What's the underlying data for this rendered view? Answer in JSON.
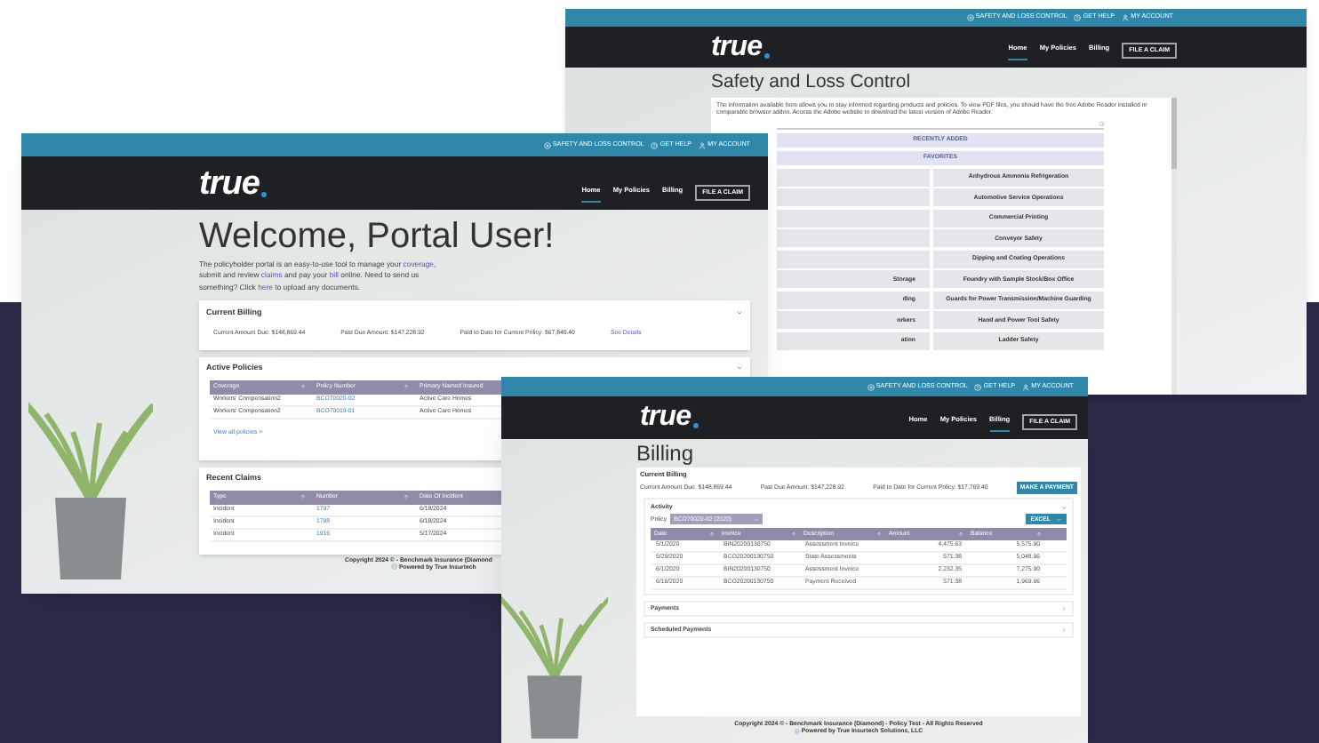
{
  "safety_window": {
    "top_links": [
      {
        "kind": "safety",
        "label": "SAFETY AND LOSS CONTROL"
      },
      {
        "kind": "help",
        "label": "GET HELP"
      },
      {
        "kind": "account",
        "label": "MY ACCOUNT"
      }
    ],
    "logo": "true",
    "nav": [
      {
        "label": "Home",
        "selected": true
      },
      {
        "label": "My Policies",
        "selected": false
      },
      {
        "label": "Billing",
        "selected": false
      }
    ],
    "claim_button": "FILE A CLAIM",
    "title": "Safety and Loss Control",
    "intro": "The information available here allows you to stay informed regarding products and policies. To view PDF files, you should have the free Adobe Reader installed or comparable browser addon. Access the Adobe website to download the latest version of Adobe Reader.",
    "sections": [
      "RECENTLY ADDED",
      "FAVORITES"
    ],
    "topics": [
      {
        "right": "Anhydrous Ammonia Refrigeration"
      },
      {
        "right": "Automotive Service Operations"
      },
      {
        "right": "Commercial Printing"
      },
      {
        "right": "Conveyor Safety"
      },
      {
        "right": "Dipping and Coating Operations"
      },
      {
        "left": "Storage",
        "right": "Foundry with Sample Stock/Box Office"
      },
      {
        "left": "ding",
        "right": "Guards for Power Transmission/Machine Guarding"
      },
      {
        "left": "orkers",
        "right": "Hand and Power Tool Safety"
      },
      {
        "left": "ation",
        "right": "Ladder Safety"
      }
    ]
  },
  "home_window": {
    "top_links": [
      {
        "kind": "safety",
        "label": "SAFETY AND LOSS CONTROL"
      },
      {
        "kind": "help",
        "label": "GET HELP"
      },
      {
        "kind": "account",
        "label": "MY ACCOUNT"
      }
    ],
    "logo": "true",
    "nav": [
      {
        "label": "Home",
        "selected": true
      },
      {
        "label": "My Policies",
        "selected": false
      },
      {
        "label": "Billing",
        "selected": false
      }
    ],
    "claim_button": "FILE A CLAIM",
    "title": "Welcome, Portal User!",
    "intro": [
      {
        "text": "The policyholder portal is an easy-to-use tool to manage your ",
        "link": false
      },
      {
        "text": "coverage",
        "link": true
      },
      {
        "text": ", submit and review ",
        "link": false
      },
      {
        "text": "claims",
        "link": true
      },
      {
        "text": " and pay your ",
        "link": false
      },
      {
        "text": "bill",
        "link": true
      },
      {
        "text": " online. Need to send us something? Click ",
        "link": false
      },
      {
        "text": "here",
        "link": true
      },
      {
        "text": " to upload any documents.",
        "link": false
      }
    ],
    "billing_card": {
      "title": "Current Billing",
      "items": [
        "Current Amount Due: $148,869.44",
        "Past Due Amount: $147,228.92",
        "Paid to Date for Current Policy: $67,840.40"
      ],
      "link": "See Details"
    },
    "policies_card": {
      "title": "Active Policies",
      "columns": [
        {
          "label": "Coverage",
          "link": false
        },
        {
          "label": "Policy Number",
          "link": true
        },
        {
          "label": "Primary Named Insured",
          "link": false
        }
      ],
      "rows": [
        [
          "Workers' Compensation2",
          "BCO70020-02",
          "Active Care Homes"
        ],
        [
          "Workers' Compensation2",
          "BCO70019-01",
          "Active Care Homes"
        ]
      ],
      "more_link": "View all policies >"
    },
    "claims_card": {
      "title": "Recent Claims",
      "columns": [
        {
          "label": "Type",
          "link": false
        },
        {
          "label": "Number",
          "link": true
        },
        {
          "label": "Date Of Incident",
          "link": false
        }
      ],
      "rows": [
        [
          "Incident",
          "1797",
          "6/18/2024"
        ],
        [
          "Incident",
          "1798",
          "6/18/2024"
        ],
        [
          "Incident",
          "1916",
          "5/17/2024"
        ]
      ]
    },
    "footer": {
      "copyright": "Copyright 2024 © - Benchmark Insurance (Diamond",
      "powered": "Powered by True Insurtech"
    }
  },
  "billing_window": {
    "top_links": [
      {
        "kind": "safety",
        "label": "SAFETY AND LOSS CONTROL"
      },
      {
        "kind": "help",
        "label": "GET HELP"
      },
      {
        "kind": "account",
        "label": "MY ACCOUNT"
      }
    ],
    "logo": "true",
    "nav": [
      {
        "label": "Home",
        "selected": false
      },
      {
        "label": "My Policies",
        "selected": false
      },
      {
        "label": "Billing",
        "selected": true
      }
    ],
    "claim_button": "FILE A CLAIM",
    "title": "Billing",
    "billing": {
      "title": "Current Billing",
      "items": [
        "Current Amount Due: $148,869.44",
        "Past Due Amount: $147,228.92",
        "Paid to Date for Current Policy: $17,769.40"
      ],
      "pay_button": "MAKE A PAYMENT"
    },
    "activity": {
      "title": "Activity",
      "policy_label": "Policy",
      "policy_value": "BCO70020-02 (2020)",
      "export_button": "EXCEL",
      "columns": [
        {
          "label": "Date",
          "numeric": false
        },
        {
          "label": "Invoice",
          "numeric": false
        },
        {
          "label": "Description",
          "numeric": false
        },
        {
          "label": "Amount",
          "numeric": true
        },
        {
          "label": "Balance",
          "numeric": true
        }
      ],
      "rows": [
        [
          "5/1/2020",
          "BIN20200130750",
          "Assessment Invoice",
          "4,475.63",
          "5,575.90"
        ],
        [
          "5/29/2020",
          "BCO20200130750",
          "State Assessments",
          "571.38",
          "5,048.96"
        ],
        [
          "6/1/2020",
          "BIN20200130750",
          "Assessment Invoice",
          "2,232.35",
          "7,275.90"
        ],
        [
          "6/16/2020",
          "BCO20200130750",
          "Payment Received",
          "571.38",
          "1,969.96"
        ]
      ]
    },
    "sections": [
      "Payments",
      "Scheduled Payments"
    ],
    "footer": {
      "copyright": "Copyright 2024 © - Benchmark Insurance (Diamond) - Policy Test - All Rights Reserved",
      "powered": "Powered by True Insurtech Solutions, LLC"
    }
  }
}
